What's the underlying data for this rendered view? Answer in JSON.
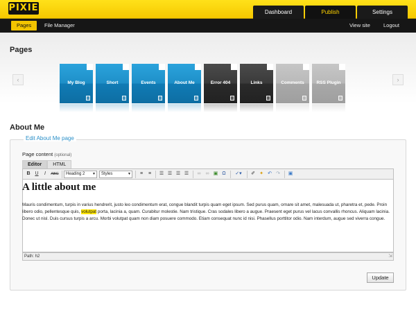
{
  "app": {
    "logo_text": "PIXIE",
    "top_tabs": [
      {
        "label": "Dashboard",
        "active": false
      },
      {
        "label": "Publish",
        "active": true
      },
      {
        "label": "Settings",
        "active": false
      }
    ],
    "accent_color": "#f3c400"
  },
  "subnav": {
    "left": [
      {
        "label": "Pages",
        "active": true
      },
      {
        "label": "File Manager",
        "active": false
      }
    ],
    "right": [
      {
        "label": "View site"
      },
      {
        "label": "Logout"
      }
    ]
  },
  "pages_section": {
    "title": "Pages",
    "tiles": [
      {
        "label": "My Blog",
        "style": "blue"
      },
      {
        "label": "Short",
        "style": "blue"
      },
      {
        "label": "Events",
        "style": "blue"
      },
      {
        "label": "About Me",
        "style": "blue"
      },
      {
        "label": "Error 404",
        "style": "dark"
      },
      {
        "label": "Links",
        "style": "dark"
      },
      {
        "label": "Comments",
        "style": "gray"
      },
      {
        "label": "RSS Plugin",
        "style": "gray"
      }
    ],
    "prev_icon": "chevron-left-icon",
    "next_icon": "chevron-right-icon"
  },
  "about_section": {
    "title": "About Me",
    "legend": "Edit About Me page",
    "field_label": "Page content",
    "field_optional": "(optional)"
  },
  "editor": {
    "tabs": [
      {
        "label": "Editor",
        "active": true
      },
      {
        "label": "HTML",
        "active": false
      }
    ],
    "format_select": "Heading 2",
    "styles_select": "Styles",
    "heading": "A little about me",
    "paragraph_before": "Mauris condimentum, turpis in varius hendrerit, justo leo condimentum erat, congue blandit turpis quam eget ipsum. Sed purus quam, ornare sit amet, malesuada ut, pharetra et, pede. Proin libero odio, pellentesque quis,",
    "highlighted": "volutpat",
    "paragraph_after": "porta, lacinia a, quam. Curabitur molestie. Nam tristique. Cras sodales libero a augue. Praesent eget purus vel lacus convallis rhoncus. Aliquam lacinia. Donec ut nisl. Duis cursus turpis a arcu. Morbi volutpat quam non diam posuere commodo. Etiam consequat nunc id nisi. Phasellus porttitor odio. Nam interdum, augue sed viverra congue.",
    "status_path": "Path: h2",
    "toolbar_bold": "B",
    "toolbar_underline": "U",
    "toolbar_italic": "I",
    "toolbar_strike": "ABC"
  },
  "actions": {
    "update_label": "Update"
  }
}
